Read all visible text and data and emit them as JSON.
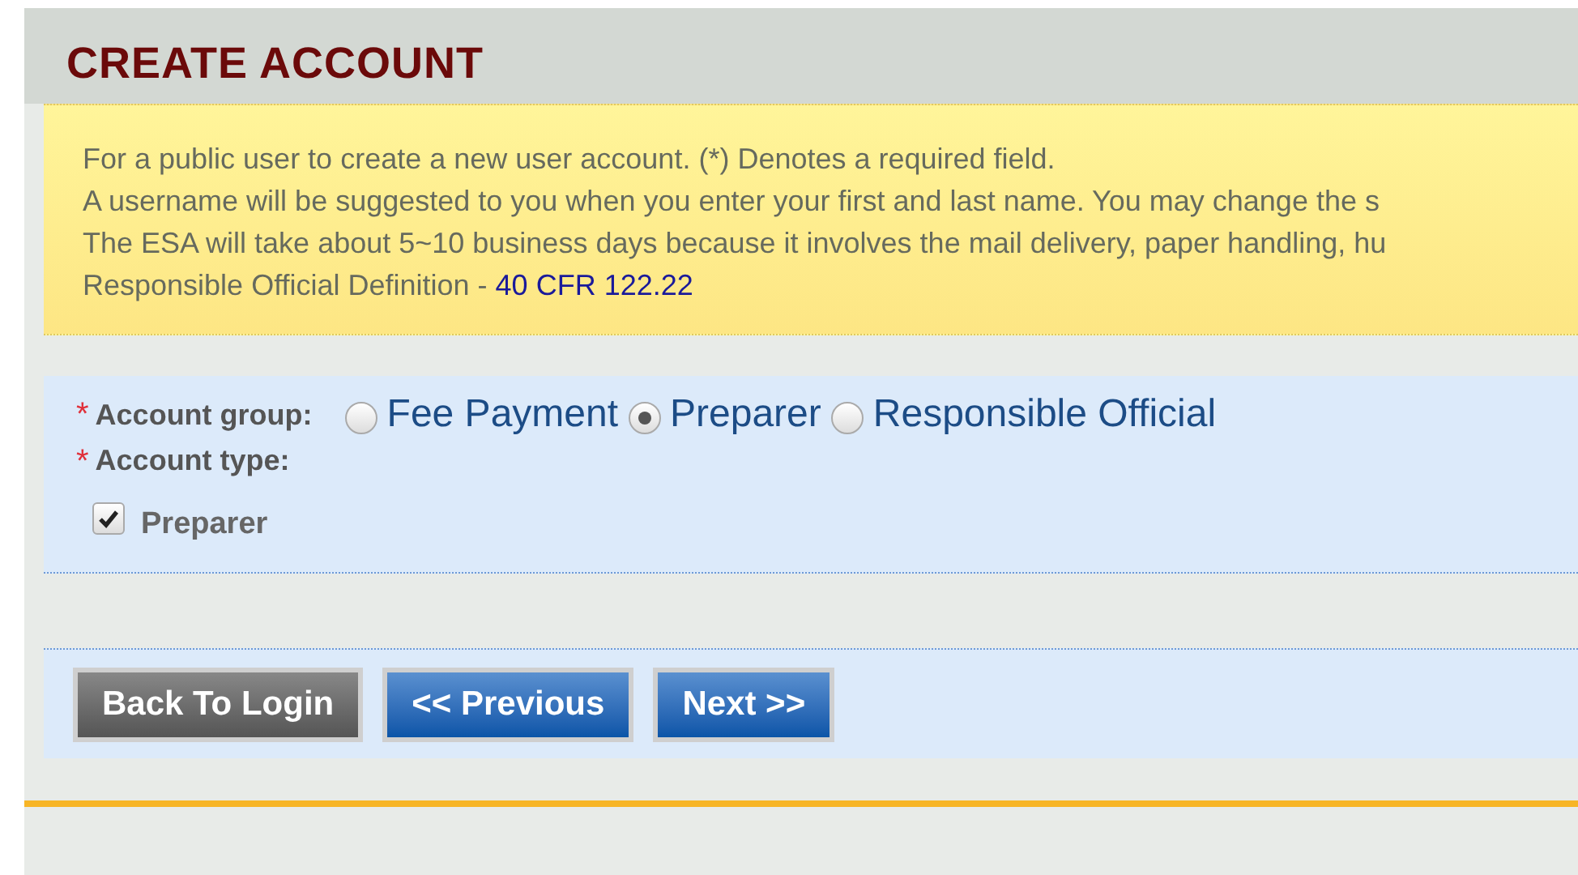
{
  "title": "CREATE ACCOUNT",
  "notice": {
    "lines": [
      "For a public user to create a new user account. (*) Denotes a required field.",
      "A username will be suggested to you when you enter your first and last name. You may change the s",
      "The ESA will take about 5~10 business days because it involves the mail delivery, paper handling, hu"
    ],
    "definition_label": "Responsible Official Definition -",
    "definition_link": "40 CFR 122.22"
  },
  "form": {
    "required_mark": "*",
    "account_group": {
      "label": "Account group:",
      "options": [
        {
          "label": "Fee Payment",
          "selected": false
        },
        {
          "label": "Preparer",
          "selected": true
        },
        {
          "label": "Responsible Official",
          "selected": false
        }
      ]
    },
    "account_type": {
      "label": "Account type:",
      "options": [
        {
          "label": "Preparer",
          "checked": true
        }
      ]
    }
  },
  "buttons": [
    {
      "label": "Back To Login",
      "kind": "secondary"
    },
    {
      "label": "<< Previous",
      "kind": "primary"
    },
    {
      "label": "Next >>",
      "kind": "primary"
    }
  ]
}
